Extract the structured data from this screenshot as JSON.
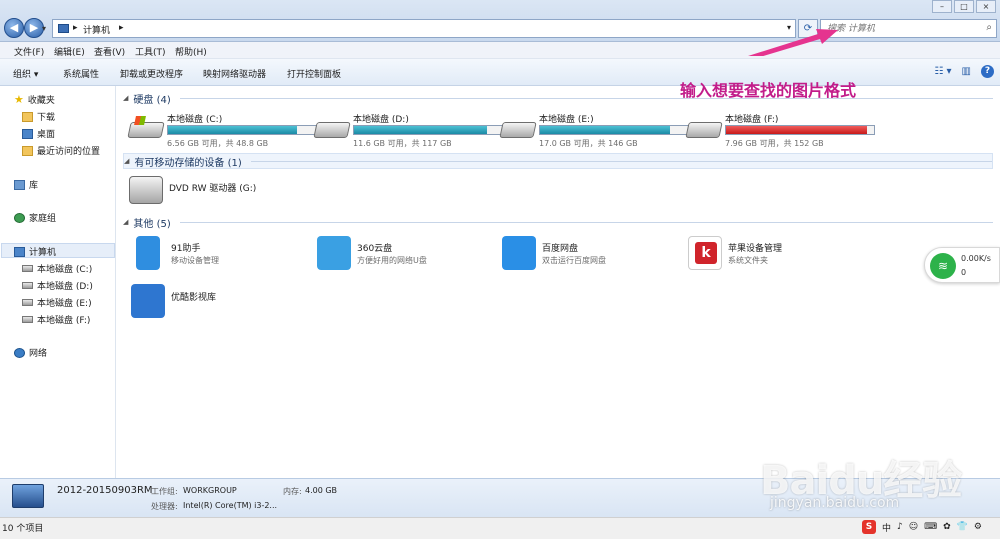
{
  "address": {
    "crumbs": [
      "计算机",
      "▸"
    ],
    "search_placeholder": "搜索 计算机"
  },
  "menu": [
    "文件(F)",
    "编辑(E)",
    "查看(V)",
    "工具(T)",
    "帮助(H)"
  ],
  "toolbar": [
    "组织 ▾",
    "系统属性",
    "卸载或更改程序",
    "映射网络驱动器",
    "打开控制面板"
  ],
  "sidebar": {
    "favorites": "收藏夹",
    "downloads": "下载",
    "desktop": "桌面",
    "recent": "最近访问的位置",
    "libraries": "库",
    "homegroup": "家庭组",
    "computer": "计算机",
    "drives": [
      "本地磁盘 (C:)",
      "本地磁盘 (D:)",
      "本地磁盘 (E:)",
      "本地磁盘 (F:)"
    ],
    "network": "网络"
  },
  "groups": {
    "hdd": "硬盘 (4)",
    "removable": "有可移动存储的设备 (1)",
    "other": "其他 (5)"
  },
  "drives": [
    {
      "name": "本地磁盘 (C:)",
      "info": "6.56 GB 可用，共 48.8 GB",
      "used_fraction": 0.87,
      "color": "#1b8aa6"
    },
    {
      "name": "本地磁盘 (D:)",
      "info": "11.6 GB 可用，共 117 GB",
      "used_fraction": 0.9,
      "color": "#1b8aa6"
    },
    {
      "name": "本地磁盘 (E:)",
      "info": "17.0 GB 可用，共 146 GB",
      "used_fraction": 0.88,
      "color": "#1b8aa6"
    },
    {
      "name": "本地磁盘 (F:)",
      "info": "7.96 GB 可用，共 152 GB",
      "used_fraction": 0.95,
      "color": "#c81a1a"
    }
  ],
  "dvd": {
    "name": "DVD RW 驱动器 (G:)"
  },
  "others": [
    {
      "name": "91助手",
      "sub": "移动设备管理",
      "color": "#2f8ee0"
    },
    {
      "name": "360云盘",
      "sub": "方便好用的网络U盘",
      "color": "#3aa0e3"
    },
    {
      "name": "百度网盘",
      "sub": "双击运行百度网盘",
      "color": "#2a8fe6"
    },
    {
      "name": "苹果设备管理",
      "sub": "系统文件夹",
      "color": "#d0242b"
    },
    {
      "name": "优酷影视库",
      "sub": "",
      "color": "#2e76d0"
    }
  ],
  "annotation": "输入想要查找的图片格式",
  "net_widget": {
    "up": "0.00K/s",
    "down": "0"
  },
  "details": {
    "pc_name": "2012-20150903RM",
    "workgroup_label": "工作组:",
    "workgroup": "WORKGROUP",
    "memory_label": "内存:",
    "memory": "4.00 GB",
    "cpu_label": "处理器:",
    "cpu": "Intel(R) Core(TM) i3-2..."
  },
  "status": {
    "count": "10 个项目"
  },
  "tray": [
    "中",
    "♪",
    "☺",
    "⌨",
    "✿",
    "👕",
    "⚙"
  ],
  "watermark": {
    "main": "Baidu经验",
    "sub": "jingyan.baidu.com"
  }
}
